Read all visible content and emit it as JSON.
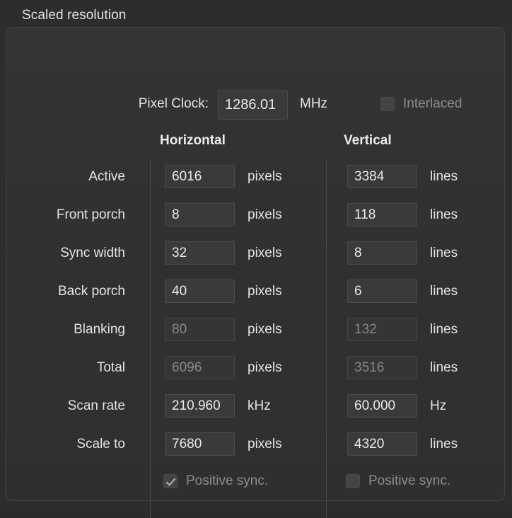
{
  "group": {
    "title": "Scaled resolution"
  },
  "pixel_clock": {
    "label": "Pixel Clock:",
    "value": "1286.01",
    "unit": "MHz"
  },
  "interlaced": {
    "label": "Interlaced",
    "checked": false
  },
  "columns": {
    "horizontal": "Horizontal",
    "vertical": "Vertical"
  },
  "rows": [
    {
      "label": "Active",
      "h_value": "6016",
      "h_unit": "pixels",
      "h_disabled": false,
      "v_value": "3384",
      "v_unit": "lines",
      "v_disabled": false
    },
    {
      "label": "Front porch",
      "h_value": "8",
      "h_unit": "pixels",
      "h_disabled": false,
      "v_value": "118",
      "v_unit": "lines",
      "v_disabled": false
    },
    {
      "label": "Sync width",
      "h_value": "32",
      "h_unit": "pixels",
      "h_disabled": false,
      "v_value": "8",
      "v_unit": "lines",
      "v_disabled": false
    },
    {
      "label": "Back porch",
      "h_value": "40",
      "h_unit": "pixels",
      "h_disabled": false,
      "v_value": "6",
      "v_unit": "lines",
      "v_disabled": false
    },
    {
      "label": "Blanking",
      "h_value": "80",
      "h_unit": "pixels",
      "h_disabled": true,
      "v_value": "132",
      "v_unit": "lines",
      "v_disabled": true
    },
    {
      "label": "Total",
      "h_value": "6096",
      "h_unit": "pixels",
      "h_disabled": true,
      "v_value": "3516",
      "v_unit": "lines",
      "v_disabled": true
    },
    {
      "label": "Scan rate",
      "h_value": "210.960",
      "h_unit": "kHz",
      "h_disabled": false,
      "v_value": "60.000",
      "v_unit": "Hz",
      "v_disabled": false
    },
    {
      "label": "Scale to",
      "h_value": "7680",
      "h_unit": "pixels",
      "h_disabled": false,
      "v_value": "4320",
      "v_unit": "lines",
      "v_disabled": false
    }
  ],
  "sync": {
    "horizontal": {
      "label": "Positive sync.",
      "checked": true
    },
    "vertical": {
      "label": "Positive sync.",
      "checked": false
    }
  },
  "colors": {
    "window_bg": "#2d2d2d",
    "panel_bg": "#313131",
    "panel_border": "#434343",
    "field_bg": "#3a3a3a",
    "field_border": "#4c4c4c",
    "text": "#e4e4e4",
    "text_disabled": "#888888",
    "separator": "#484848"
  },
  "layout": {
    "row_tops": [
      233,
      287,
      341,
      395,
      449,
      503,
      557,
      611
    ]
  }
}
